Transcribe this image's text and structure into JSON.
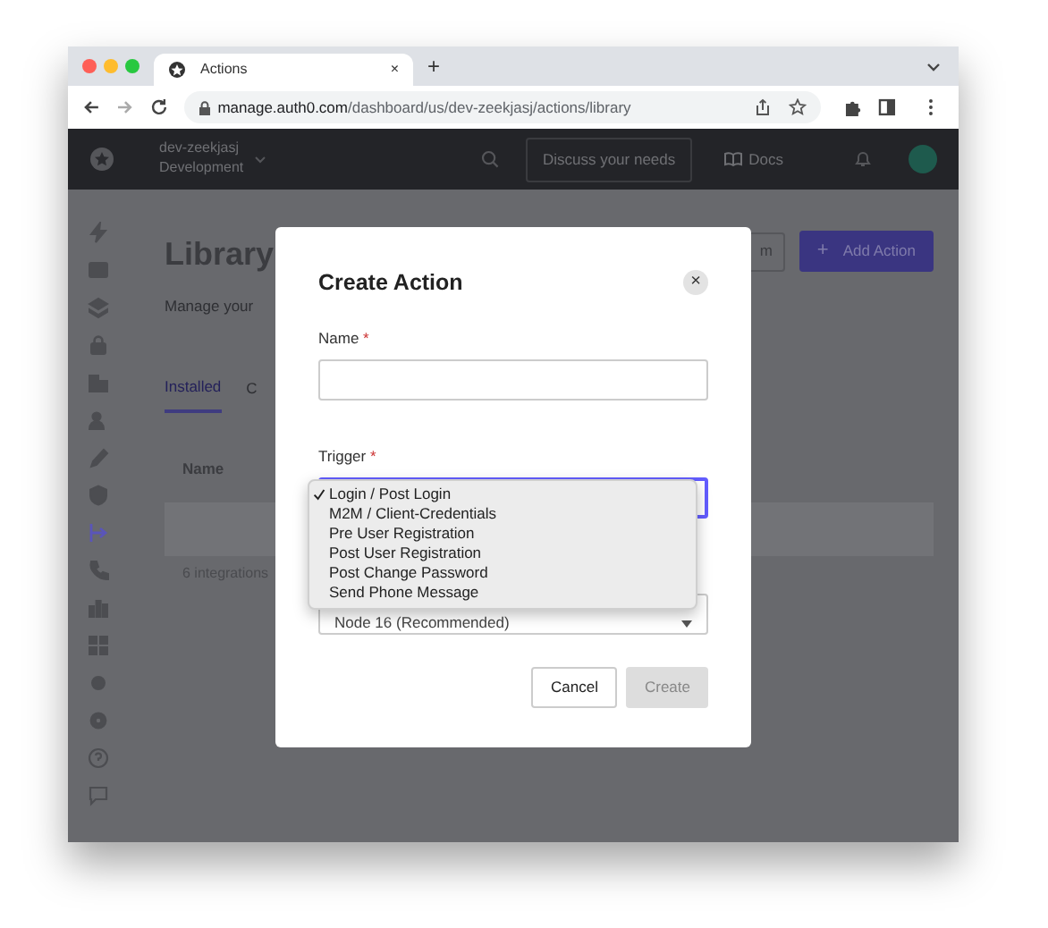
{
  "browser": {
    "tab": {
      "title": "Actions",
      "close": "×"
    },
    "new_tab": "+",
    "url": {
      "domain": "manage.auth0.com",
      "path": "/dashboard/us/dev-zeekjasj/actions/library"
    }
  },
  "header": {
    "tenant": "dev-zeekjasj",
    "environment": "Development",
    "discuss_button": "Discuss your needs",
    "docs_link": "Docs"
  },
  "sidebar": {
    "items": [
      {
        "kind": "bolt",
        "selected": false
      },
      {
        "kind": "chart",
        "selected": false
      },
      {
        "kind": "stack",
        "selected": false
      },
      {
        "kind": "lock",
        "selected": false
      },
      {
        "kind": "building",
        "selected": false
      },
      {
        "kind": "user",
        "selected": false
      },
      {
        "kind": "pen",
        "selected": false
      },
      {
        "kind": "shield",
        "selected": false
      },
      {
        "kind": "flow",
        "selected": true
      },
      {
        "kind": "phone",
        "selected": false
      },
      {
        "kind": "bars",
        "selected": false
      },
      {
        "kind": "grid",
        "selected": false
      },
      {
        "kind": "dot",
        "selected": false
      },
      {
        "kind": "gear",
        "selected": false
      },
      {
        "kind": "help",
        "selected": false
      },
      {
        "kind": "chat",
        "selected": false
      }
    ]
  },
  "page": {
    "title": "Library",
    "subtitle": "Manage your",
    "tabs": [
      {
        "label": "Installed",
        "selected": true
      },
      {
        "label": "C",
        "selected": false
      }
    ],
    "table": {
      "columns": [
        "Name"
      ]
    },
    "footer": "6 integrations",
    "buttons": [
      {
        "label": "m",
        "kind": "outline"
      },
      {
        "label": "Add Action",
        "icon": "+",
        "kind": "primary"
      }
    ]
  },
  "modal": {
    "title": "Create Action",
    "close": "×",
    "name_field": {
      "label": "Name",
      "required_mark": "*"
    },
    "trigger_field": {
      "label": "Trigger",
      "required_mark": "*",
      "focused": true
    },
    "trigger_options": [
      {
        "label": "Login / Post Login",
        "selected": true
      },
      {
        "label": "M2M / Client-Credentials",
        "selected": false
      },
      {
        "label": "Pre User Registration",
        "selected": false
      },
      {
        "label": "Post User Registration",
        "selected": false
      },
      {
        "label": "Post Change Password",
        "selected": false
      },
      {
        "label": "Send Phone Message",
        "selected": false
      }
    ],
    "runtime_field": {
      "value": "Node 16 (Recommended)"
    },
    "buttons": [
      {
        "label": "Cancel",
        "disabled": false
      },
      {
        "label": "Create",
        "disabled": true
      }
    ]
  }
}
